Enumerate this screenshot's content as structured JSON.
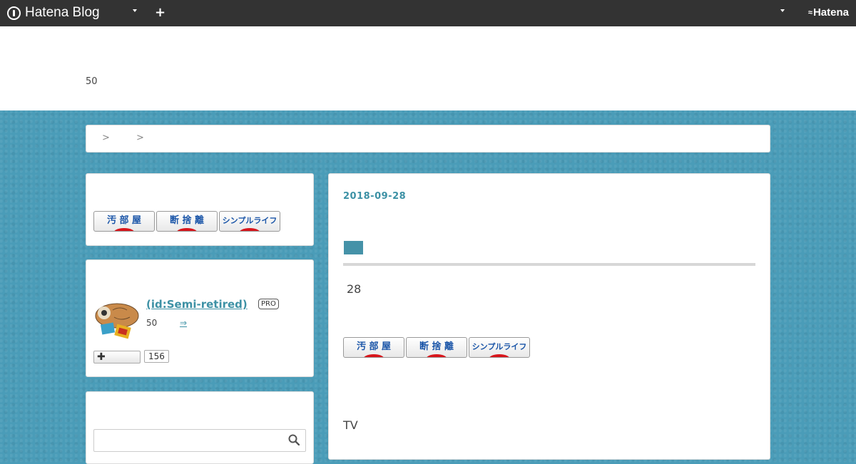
{
  "topbar": {
    "logo_text": "Hatena Blog",
    "brand": "Hatena",
    "colors": {
      "bar": "#333333"
    }
  },
  "header": {
    "description": "50"
  },
  "breadcrumb": {
    "items": [
      {
        "label": ""
      },
      {
        "label": ""
      }
    ],
    "separator": ">"
  },
  "sidebar": {
    "badges": [
      {
        "label": "汚 部 屋"
      },
      {
        "label": "断 捨 離"
      },
      {
        "label": "シンプルライフ"
      }
    ],
    "profile": {
      "name": " (id:Semi-retired)",
      "badge": "PRO",
      "description": "50",
      "more_link": "⇒",
      "subscribe_label": "✚",
      "subscriber_count": "156"
    },
    "search": {
      "placeholder": "",
      "icon": "search-icon"
    }
  },
  "article": {
    "date": "2018-09-28",
    "category_color": "#4592a8",
    "paragraph1": "28",
    "badges": [
      {
        "label": "汚 部 屋"
      },
      {
        "label": "断 捨 離"
      },
      {
        "label": "シンプルライフ"
      }
    ],
    "paragraph2": "TV"
  }
}
